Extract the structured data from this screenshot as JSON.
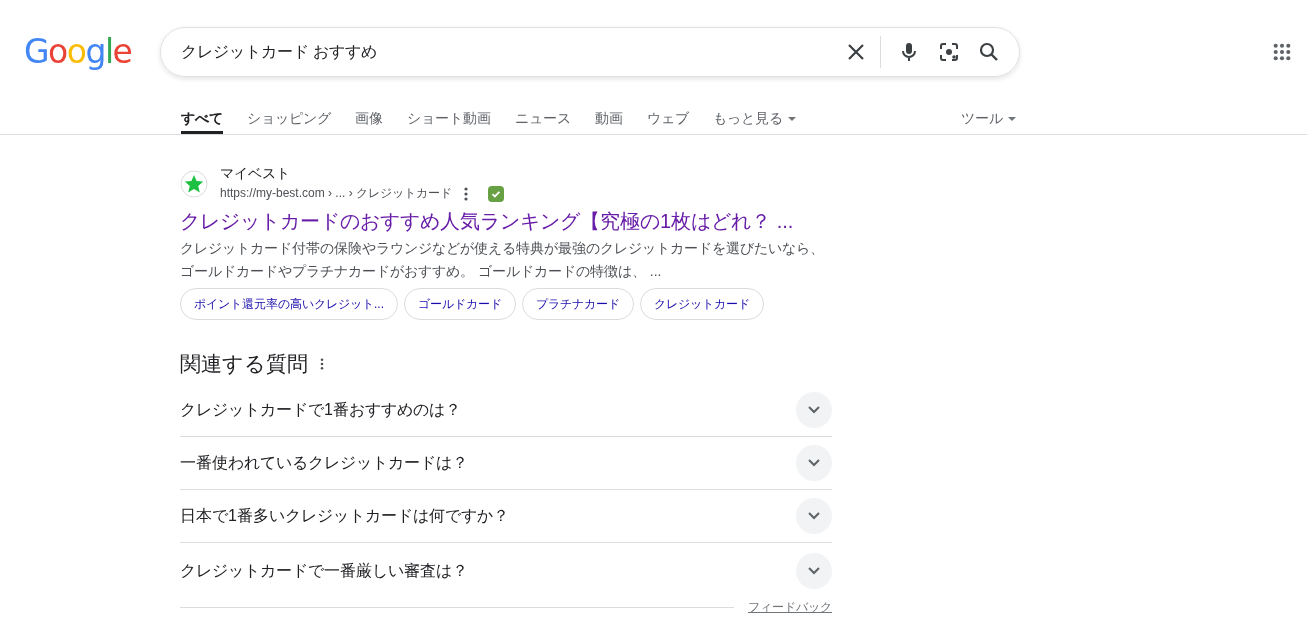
{
  "logo": "Google",
  "search": {
    "value": "クレジットカード おすすめ"
  },
  "tabs": [
    {
      "label": "すべて",
      "selected": true,
      "kind": "plain"
    },
    {
      "label": "ショッピング",
      "selected": false,
      "kind": "plain"
    },
    {
      "label": "画像",
      "selected": false,
      "kind": "plain"
    },
    {
      "label": "ショート動画",
      "selected": false,
      "kind": "plain"
    },
    {
      "label": "ニュース",
      "selected": false,
      "kind": "plain"
    },
    {
      "label": "動画",
      "selected": false,
      "kind": "plain"
    },
    {
      "label": "ウェブ",
      "selected": false,
      "kind": "plain"
    },
    {
      "label": "もっと見る",
      "selected": false,
      "kind": "menu"
    }
  ],
  "tools": {
    "label": "ツール"
  },
  "result": {
    "site": "マイベスト",
    "url": "https://my-best.com › ... › クレジットカード",
    "verified": true,
    "title": "クレジットカードのおすすめ人気ランキング【究極の1枚はどれ？ ...",
    "snippet": "クレジットカード付帯の保険やラウンジなどが使える特典が最強のクレジットカードを選びたいなら、ゴールドカードやプラチナカードがおすすめ。 ゴールドカードの特徴は、 ...",
    "chips": [
      "ポイント還元率の高いクレジット...",
      "ゴールドカード",
      "プラチナカード",
      "クレジットカード"
    ]
  },
  "related": {
    "heading": "関連する質問",
    "questions": [
      {
        "text": "クレジットカードで1番おすすめのは？",
        "expanded": false
      },
      {
        "text": "一番使われているクレジットカードは？",
        "expanded": false
      },
      {
        "text": "日本で1番多いクレジットカードは何ですか？",
        "expanded": false
      },
      {
        "text": "クレジットカードで一番厳しい審査は？",
        "expanded": false
      }
    ],
    "feedback": "フィードバック"
  }
}
